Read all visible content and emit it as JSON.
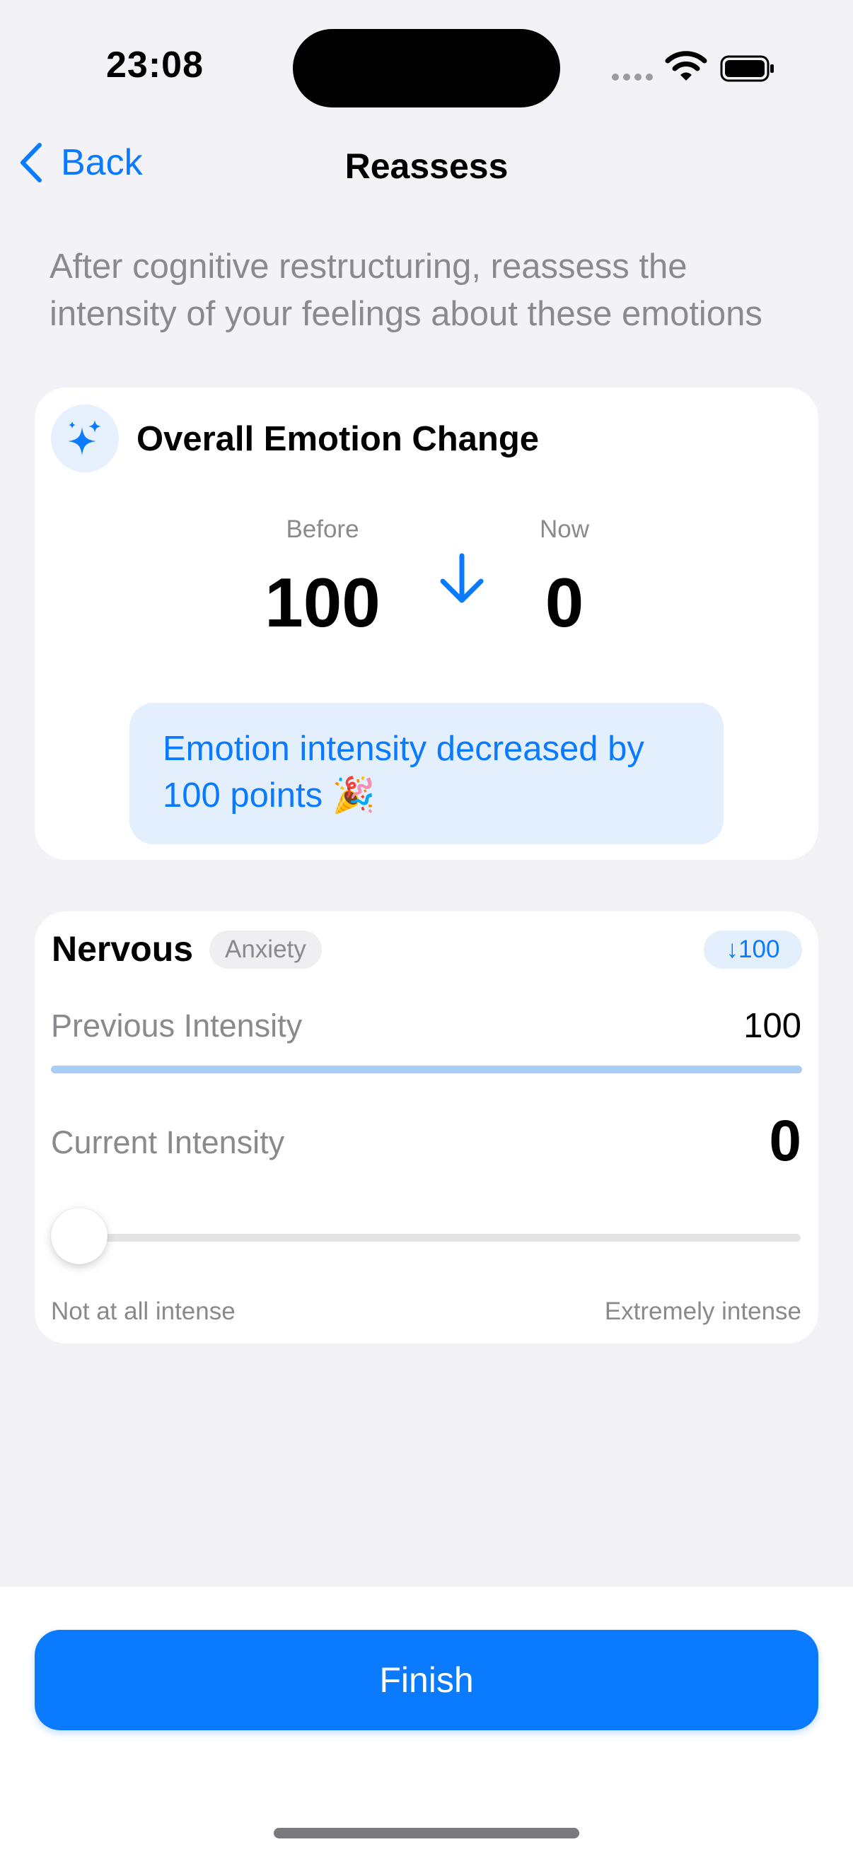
{
  "status_bar": {
    "time": "23:08"
  },
  "nav": {
    "back_label": "Back",
    "title": "Reassess"
  },
  "intro": "After cognitive restructuring, reassess the intensity of your feelings about these emotions",
  "overall": {
    "title": "Overall Emotion Change",
    "before_label": "Before",
    "before_value": "100",
    "now_label": "Now",
    "now_value": "0",
    "message": "Emotion intensity decreased by 100 points 🎉"
  },
  "emotion": {
    "name": "Nervous",
    "category": "Anxiety",
    "delta": "↓100",
    "previous_label": "Previous Intensity",
    "previous_value": "100",
    "previous_fraction": 1.0,
    "current_label": "Current Intensity",
    "current_value": "0",
    "slider_value": 0,
    "slider_min_label": "Not at all intense",
    "slider_max_label": "Extremely intense"
  },
  "finish_label": "Finish",
  "colors": {
    "accent": "#0A7AFF",
    "background": "#F2F2F7",
    "card": "#FFFFFF",
    "muted_text": "#8A8A8E"
  }
}
